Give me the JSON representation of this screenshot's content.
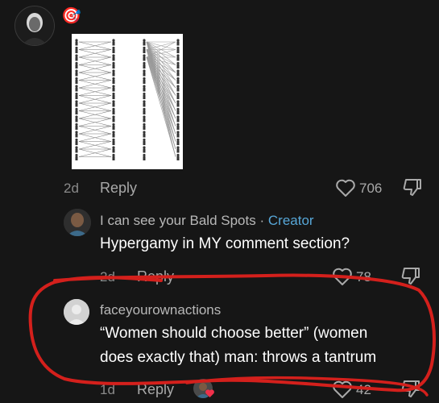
{
  "comment_main": {
    "emoji": "🎯",
    "time": "2d",
    "reply_label": "Reply",
    "likes": "706"
  },
  "reply_1": {
    "username": "I can see your Bald Spots",
    "separator": "·",
    "badge": "Creator",
    "text": "Hypergamy in MY comment section?",
    "time": "2d",
    "reply_label": "Reply",
    "likes": "78"
  },
  "reply_2": {
    "username": "faceyourownactions",
    "text_line1": "“Women should choose better” (women",
    "text_line2": "does exactly that) man: throws a tantrum",
    "time": "1d",
    "reply_label": "Reply",
    "likes": "42"
  },
  "colors": {
    "background": "#161616",
    "annotation_red": "#d4201c",
    "creator_blue": "#57a7d8"
  }
}
